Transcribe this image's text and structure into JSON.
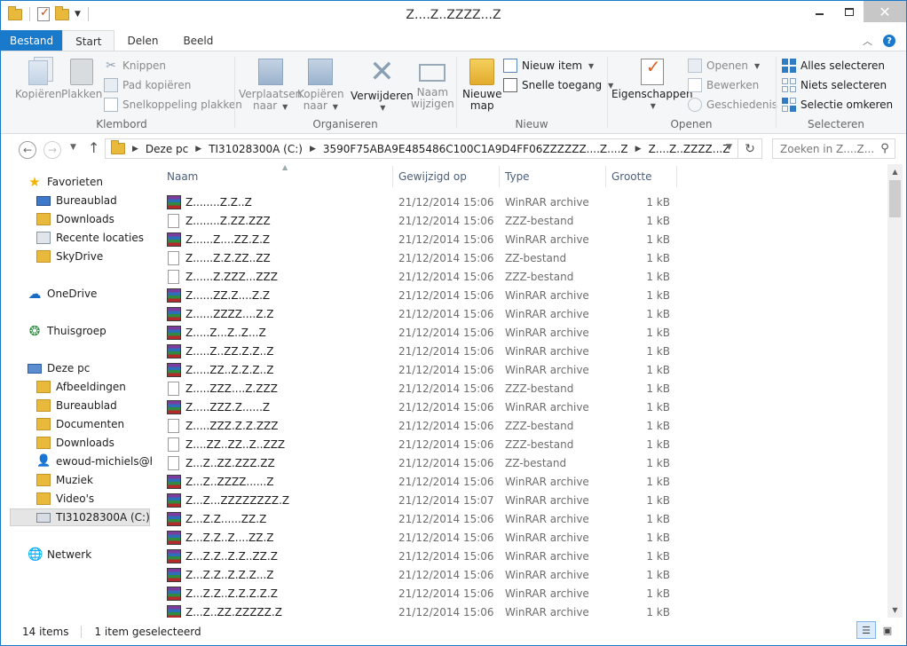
{
  "window": {
    "title": "Z....Z..ZZZZ...Z"
  },
  "tabs": [
    "Bestand",
    "Start",
    "Delen",
    "Beeld"
  ],
  "ribbon": {
    "clipboard": {
      "label": "Klembord",
      "copy": "Kopiëren",
      "paste": "Plakken",
      "cut": "Knippen",
      "copy_path": "Pad kopiëren",
      "paste_shortcut": "Snelkoppeling plakken"
    },
    "organize": {
      "label": "Organiseren",
      "move_to_1": "Verplaatsen",
      "move_to_2": "naar",
      "copy_to_1": "Kopiëren",
      "copy_to_2": "naar",
      "delete": "Verwijderen",
      "rename_1": "Naam",
      "rename_2": "wijzigen"
    },
    "new": {
      "label": "Nieuw",
      "new_folder_1": "Nieuwe",
      "new_folder_2": "map",
      "new_item": "Nieuw item",
      "easy_access": "Snelle toegang"
    },
    "open": {
      "label": "Openen",
      "properties": "Eigenschappen",
      "open": "Openen",
      "edit": "Bewerken",
      "history": "Geschiedenis"
    },
    "select": {
      "label": "Selecteren",
      "select_all": "Alles selecteren",
      "select_none": "Niets selecteren",
      "invert": "Selectie omkeren"
    }
  },
  "address": {
    "crumbs": [
      "Deze pc",
      "TI31028300A (C:)",
      "3590F75ABA9E485486C100C1A9D4FF06ZZZZZZ....Z....Z",
      "Z....Z..ZZZZ...Z"
    ],
    "search_placeholder": "Zoeken in Z....Z..."
  },
  "nav": {
    "favorites": "Favorieten",
    "fav_items": [
      "Bureaublad",
      "Downloads",
      "Recente locaties",
      "SkyDrive"
    ],
    "onedrive": "OneDrive",
    "homegroup": "Thuisgroep",
    "this_pc": "Deze pc",
    "pc_items": [
      "Afbeeldingen",
      "Bureaublad",
      "Documenten",
      "Downloads",
      "ewoud-michiels@hotmail.com",
      "Muziek",
      "Video's",
      "TI31028300A (C:)"
    ],
    "network": "Netwerk"
  },
  "columns": {
    "name": "Naam",
    "modified": "Gewijzigd op",
    "type": "Type",
    "size": "Grootte"
  },
  "files": [
    {
      "name": "Z........Z.Z..Z",
      "date": "21/12/2014 15:06",
      "type": "WinRAR archive",
      "size": "1 kB",
      "icon": "winrar-archive-icon"
    },
    {
      "name": "Z........Z.ZZ.ZZZ",
      "date": "21/12/2014 15:06",
      "type": "ZZZ-bestand",
      "size": "1 kB",
      "icon": "file-icon"
    },
    {
      "name": "Z......Z....ZZ.Z.Z",
      "date": "21/12/2014 15:06",
      "type": "WinRAR archive",
      "size": "1 kB",
      "icon": "winrar-archive-icon"
    },
    {
      "name": "Z......Z.Z.ZZ..ZZ",
      "date": "21/12/2014 15:06",
      "type": "ZZ-bestand",
      "size": "1 kB",
      "icon": "file-icon"
    },
    {
      "name": "Z......Z.ZZZ...ZZZ",
      "date": "21/12/2014 15:06",
      "type": "ZZZ-bestand",
      "size": "1 kB",
      "icon": "file-icon"
    },
    {
      "name": "Z......ZZ.Z....Z.Z",
      "date": "21/12/2014 15:06",
      "type": "WinRAR archive",
      "size": "1 kB",
      "icon": "winrar-archive-icon"
    },
    {
      "name": "Z......ZZZZ....Z.Z",
      "date": "21/12/2014 15:06",
      "type": "WinRAR archive",
      "size": "1 kB",
      "icon": "winrar-archive-icon"
    },
    {
      "name": "Z.....Z...Z..Z...Z",
      "date": "21/12/2014 15:06",
      "type": "WinRAR archive",
      "size": "1 kB",
      "icon": "winrar-archive-icon"
    },
    {
      "name": "Z.....Z..ZZ.Z.Z..Z",
      "date": "21/12/2014 15:06",
      "type": "WinRAR archive",
      "size": "1 kB",
      "icon": "winrar-archive-icon"
    },
    {
      "name": "Z.....ZZ..Z.Z.Z..Z",
      "date": "21/12/2014 15:06",
      "type": "WinRAR archive",
      "size": "1 kB",
      "icon": "winrar-archive-icon"
    },
    {
      "name": "Z.....ZZZ....Z.ZZZ",
      "date": "21/12/2014 15:06",
      "type": "ZZZ-bestand",
      "size": "1 kB",
      "icon": "file-icon"
    },
    {
      "name": "Z.....ZZZ.Z......Z",
      "date": "21/12/2014 15:06",
      "type": "WinRAR archive",
      "size": "1 kB",
      "icon": "winrar-archive-icon"
    },
    {
      "name": "Z.....ZZZ.Z.Z.ZZZ",
      "date": "21/12/2014 15:06",
      "type": "ZZZ-bestand",
      "size": "1 kB",
      "icon": "file-icon"
    },
    {
      "name": "Z....ZZ..ZZ..Z..ZZZ",
      "date": "21/12/2014 15:06",
      "type": "ZZZ-bestand",
      "size": "1 kB",
      "icon": "file-icon"
    },
    {
      "name": "Z...Z..ZZ.ZZZ.ZZ",
      "date": "21/12/2014 15:06",
      "type": "ZZ-bestand",
      "size": "1 kB",
      "icon": "file-icon"
    },
    {
      "name": "Z...Z..ZZZZ......Z",
      "date": "21/12/2014 15:06",
      "type": "WinRAR archive",
      "size": "1 kB",
      "icon": "winrar-archive-icon"
    },
    {
      "name": "Z...Z...ZZZZZZZZ.Z",
      "date": "21/12/2014 15:07",
      "type": "WinRAR archive",
      "size": "1 kB",
      "icon": "winrar-archive-icon"
    },
    {
      "name": "Z...Z.Z......ZZ.Z",
      "date": "21/12/2014 15:06",
      "type": "WinRAR archive",
      "size": "1 kB",
      "icon": "winrar-archive-icon"
    },
    {
      "name": "Z...Z.Z..Z....ZZ.Z",
      "date": "21/12/2014 15:06",
      "type": "WinRAR archive",
      "size": "1 kB",
      "icon": "winrar-archive-icon"
    },
    {
      "name": "Z...Z.Z..Z.Z..ZZ.Z",
      "date": "21/12/2014 15:06",
      "type": "WinRAR archive",
      "size": "1 kB",
      "icon": "winrar-archive-icon"
    },
    {
      "name": "Z...Z.Z..Z.Z.Z...Z",
      "date": "21/12/2014 15:06",
      "type": "WinRAR archive",
      "size": "1 kB",
      "icon": "winrar-archive-icon"
    },
    {
      "name": "Z...Z.Z..Z.Z.Z.Z.Z",
      "date": "21/12/2014 15:06",
      "type": "WinRAR archive",
      "size": "1 kB",
      "icon": "winrar-archive-icon"
    },
    {
      "name": "Z...Z..ZZ.ZZZZZ.Z",
      "date": "21/12/2014 15:06",
      "type": "WinRAR archive",
      "size": "1 kB",
      "icon": "winrar-archive-icon"
    }
  ],
  "status": {
    "items": "14 items",
    "selected": "1 item geselecteerd"
  }
}
